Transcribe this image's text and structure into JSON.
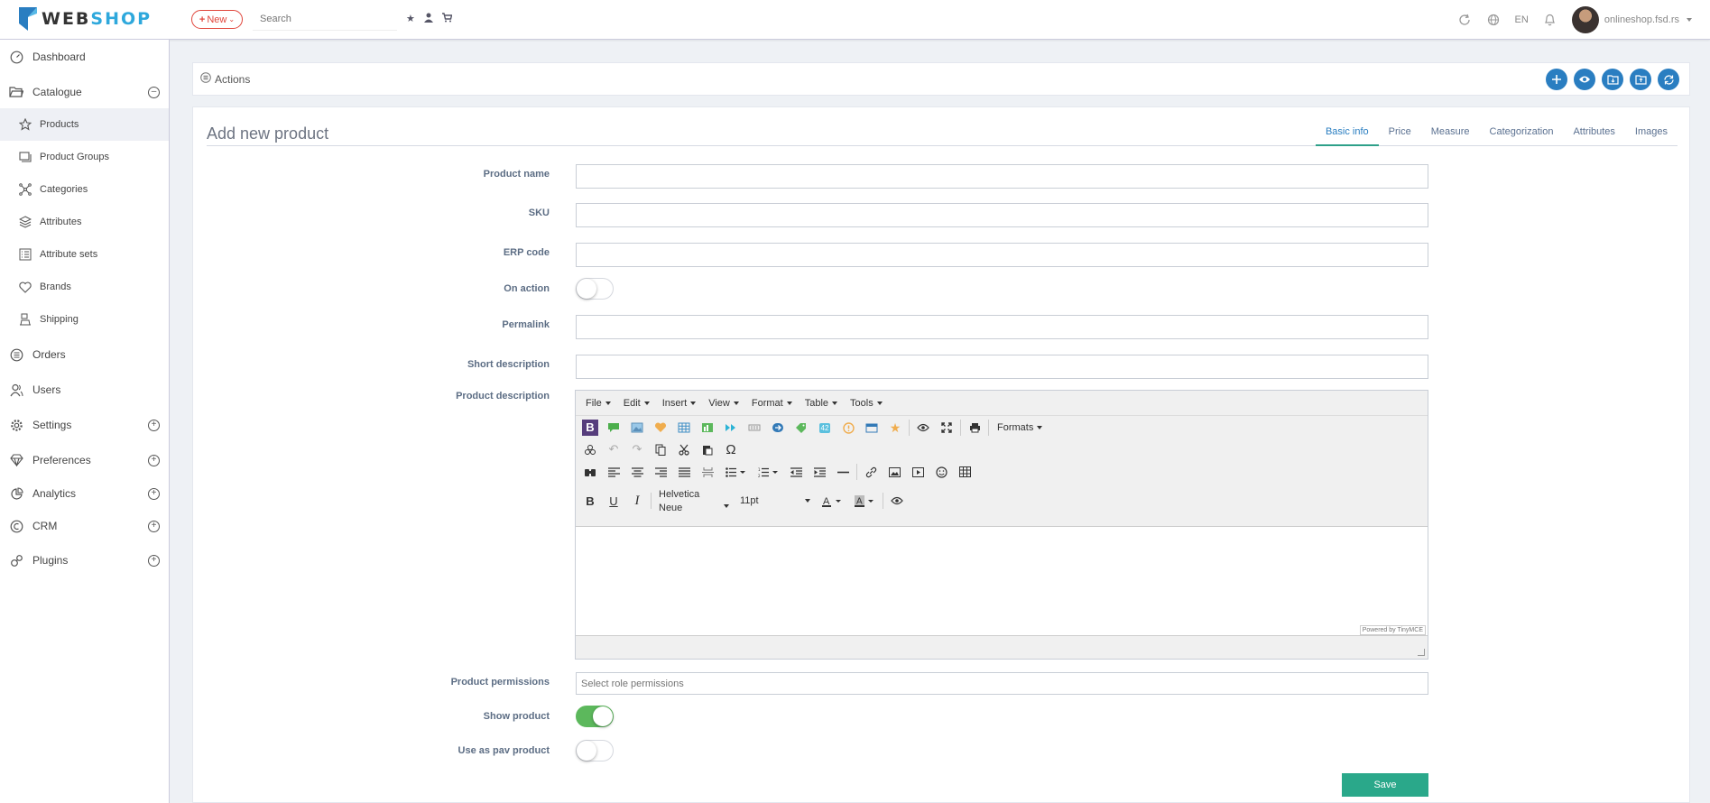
{
  "brand": {
    "logo_part1": "WEB",
    "logo_part2": "SHOP"
  },
  "topbar": {
    "new_label": "New",
    "search_placeholder": "Search",
    "language": "EN",
    "user": "onlineshop.fsd.rs"
  },
  "sidebar": {
    "items": [
      {
        "label": "Dashboard"
      },
      {
        "label": "Catalogue"
      },
      {
        "label": "Products"
      },
      {
        "label": "Product Groups"
      },
      {
        "label": "Categories"
      },
      {
        "label": "Attributes"
      },
      {
        "label": "Attribute sets"
      },
      {
        "label": "Brands"
      },
      {
        "label": "Shipping"
      },
      {
        "label": "Orders"
      },
      {
        "label": "Users"
      },
      {
        "label": "Settings"
      },
      {
        "label": "Preferences"
      },
      {
        "label": "Analytics"
      },
      {
        "label": "CRM"
      },
      {
        "label": "Plugins"
      }
    ]
  },
  "actions": {
    "label": "Actions"
  },
  "page": {
    "title": "Add new product",
    "tabs": [
      "Basic info",
      "Price",
      "Measure",
      "Categorization",
      "Attributes",
      "Images"
    ]
  },
  "form": {
    "product_name": "Product name",
    "sku": "SKU",
    "erp_code": "ERP code",
    "on_action": "On action",
    "permalink": "Permalink",
    "short_description": "Short description",
    "product_description": "Product description",
    "product_permissions": "Product permissions",
    "permissions_placeholder": "Select role permissions",
    "show_product": "Show product",
    "use_as_pav": "Use as pav product",
    "save": "Save"
  },
  "editor": {
    "menus": [
      "File",
      "Edit",
      "Insert",
      "View",
      "Format",
      "Table",
      "Tools"
    ],
    "formats": "Formats",
    "font_family": "Helvetica Neue",
    "font_size": "11pt",
    "powered": "Powered by TinyMCE"
  },
  "colors": {
    "accent": "#2a7ec1",
    "save": "#2aa88a",
    "new": "#e0453b",
    "switch_on": "#5cb85c"
  }
}
